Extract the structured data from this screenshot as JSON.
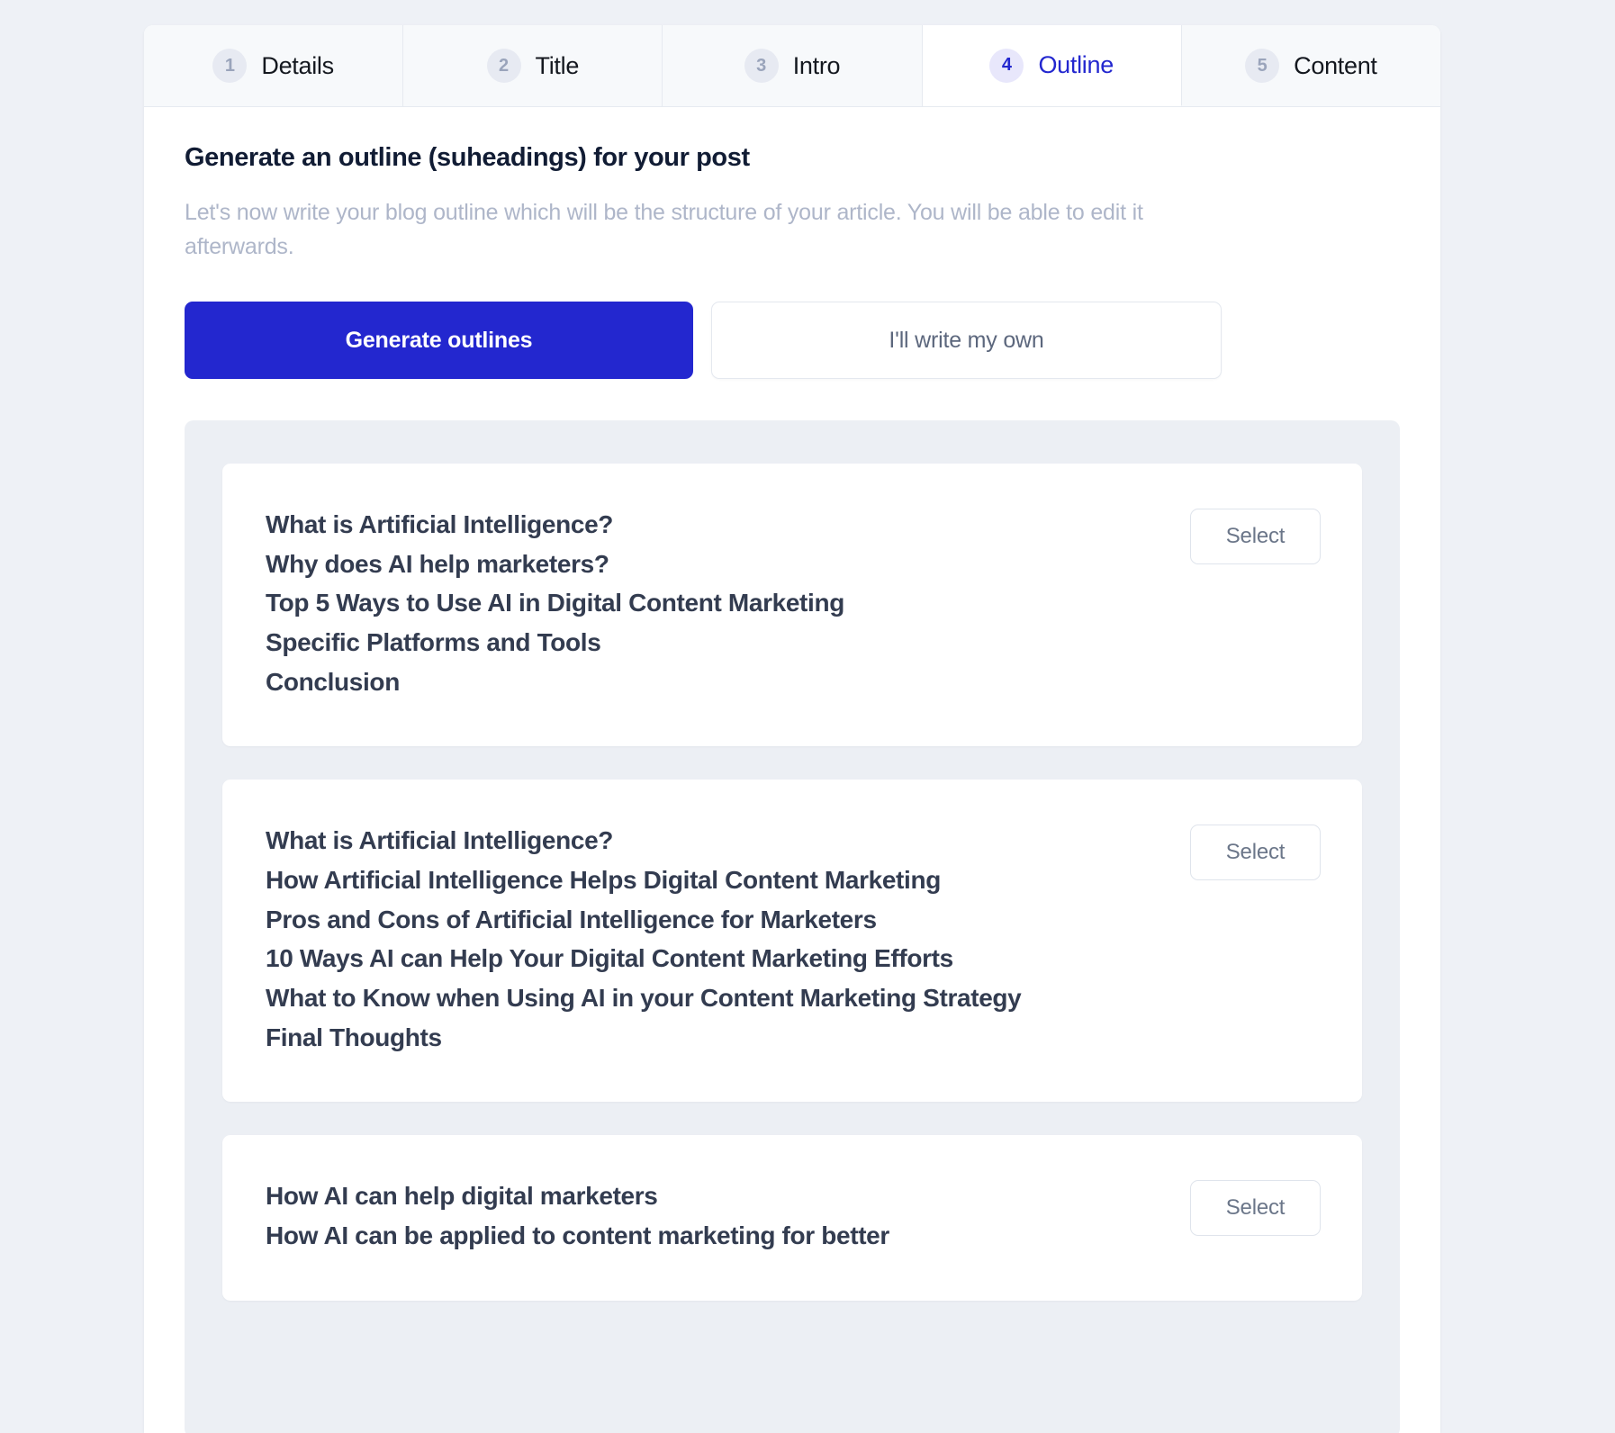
{
  "steps": [
    {
      "number": "1",
      "label": "Details",
      "active": false
    },
    {
      "number": "2",
      "label": "Title",
      "active": false
    },
    {
      "number": "3",
      "label": "Intro",
      "active": false
    },
    {
      "number": "4",
      "label": "Outline",
      "active": true
    },
    {
      "number": "5",
      "label": "Content",
      "active": false
    }
  ],
  "page": {
    "title": "Generate an outline (suheadings) for your post",
    "description": "Let's now write your blog outline which will be the structure of your article. You will be able to edit it afterwards."
  },
  "actions": {
    "generate_label": "Generate outlines",
    "write_own_label": "I'll write my own"
  },
  "select_label": "Select",
  "outlines": [
    {
      "select_label": "Select",
      "lines": [
        "What is Artificial Intelligence?",
        "Why does AI help marketers?",
        "Top 5 Ways to Use AI in Digital Content Marketing",
        "Specific Platforms and Tools",
        "Conclusion"
      ]
    },
    {
      "select_label": "Select",
      "lines": [
        "What is Artificial Intelligence?",
        "How Artificial Intelligence Helps Digital Content Marketing",
        "Pros and Cons of Artificial Intelligence for Marketers",
        "10 Ways AI can Help Your Digital Content Marketing Efforts",
        "What to Know when Using AI in your Content Marketing Strategy",
        "Final Thoughts"
      ]
    },
    {
      "select_label": "Select",
      "lines": [
        "How AI can help digital marketers",
        "How AI can be applied to content marketing for better"
      ]
    }
  ],
  "colors": {
    "accent": "#2327cf",
    "page_bg": "#eef1f6",
    "well_bg": "#eceff4",
    "card_bg": "#ffffff",
    "heading": "#111c34",
    "muted": "#aeb6c9",
    "outline_text": "#333c50"
  }
}
